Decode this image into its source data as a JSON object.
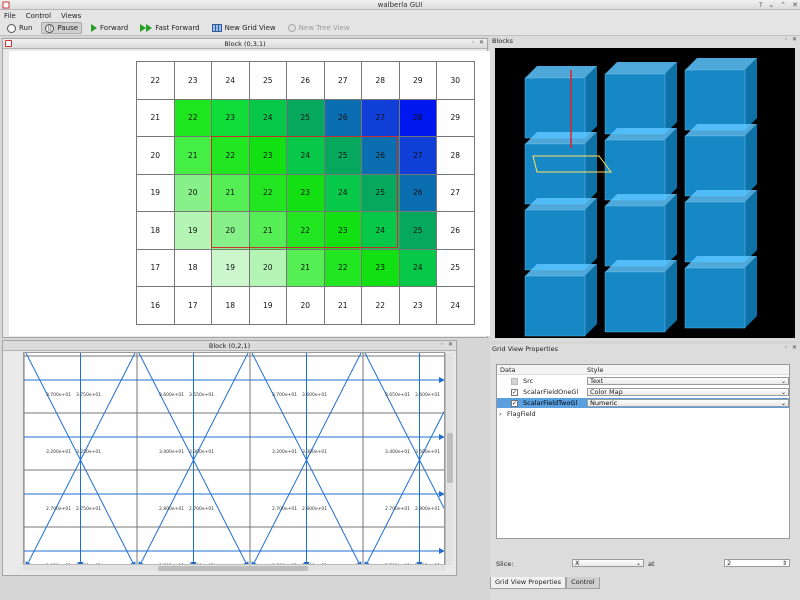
{
  "window": {
    "title": "walberla GUI"
  },
  "menu": [
    "File",
    "Control",
    "Views"
  ],
  "toolbar": {
    "run": "Run",
    "pause": "Pause",
    "forward": "Forward",
    "fast_forward": "Fast Forward",
    "new_grid_view": "New Grid View",
    "new_tree_view": "New Tree View"
  },
  "block1": {
    "title": "Block (0,3,1)",
    "rows": [
      [
        "22",
        "23",
        "24",
        "25",
        "26",
        "27",
        "28",
        "29",
        "30"
      ],
      [
        "21",
        "22",
        "23",
        "24",
        "25",
        "26",
        "27",
        "28",
        "29"
      ],
      [
        "20",
        "21",
        "22",
        "23",
        "24",
        "25",
        "26",
        "27",
        "28"
      ],
      [
        "19",
        "20",
        "21",
        "22",
        "23",
        "24",
        "25",
        "26",
        "27"
      ],
      [
        "18",
        "19",
        "20",
        "21",
        "22",
        "23",
        "24",
        "25",
        "26"
      ],
      [
        "17",
        "18",
        "19",
        "20",
        "21",
        "22",
        "23",
        "24",
        "25"
      ],
      [
        "16",
        "17",
        "18",
        "19",
        "20",
        "21",
        "22",
        "23",
        "24"
      ]
    ],
    "colors": [
      [
        "#ffffff",
        "#ffffff",
        "#ffffff",
        "#ffffff",
        "#ffffff",
        "#ffffff",
        "#ffffff",
        "#ffffff",
        "#ffffff"
      ],
      [
        "#ffffff",
        "#1ee61e",
        "#10dd3a",
        "#08c84a",
        "#06a85e",
        "#0a6eb0",
        "#1040d8",
        "#0018f0",
        "#ffffff"
      ],
      [
        "#ffffff",
        "#44ee44",
        "#22e622",
        "#12e012",
        "#08c84a",
        "#06a85e",
        "#0a6eb0",
        "#1040d8",
        "#ffffff"
      ],
      [
        "#ffffff",
        "#88f088",
        "#55ee55",
        "#22e622",
        "#12e012",
        "#08c84a",
        "#06a85e",
        "#0a6eb0",
        "#ffffff"
      ],
      [
        "#ffffff",
        "#b4f4b4",
        "#88f088",
        "#55ee55",
        "#22e622",
        "#12e012",
        "#08c84a",
        "#06a85e",
        "#ffffff"
      ],
      [
        "#ffffff",
        "#ffffff",
        "#ccf7cc",
        "#b4f4b4",
        "#55ee55",
        "#22e622",
        "#12e012",
        "#08c84a",
        "#ffffff"
      ],
      [
        "#ffffff",
        "#ffffff",
        "#ffffff",
        "#ffffff",
        "#ffffff",
        "#ffffff",
        "#ffffff",
        "#ffffff",
        "#ffffff"
      ]
    ]
  },
  "block2": {
    "title": "Block (0,2,1)",
    "labels": [
      [
        "3.700e+01",
        "3.750e+01",
        "3.600e+01",
        "3.550e+01",
        "3.700e+01",
        "3.600e+01",
        "3.650e+01",
        "3.600e+01"
      ],
      [
        "3.200e+01",
        "3.250e+01",
        "3.400e+01",
        "3.300e+01",
        "3.200e+01",
        "3.300e+01",
        "3.400e+01",
        "3.500e+01"
      ],
      [
        "2.700e+01",
        "2.750e+01",
        "2.800e+01",
        "2.700e+01",
        "2.700e+01",
        "2.800e+01",
        "2.700e+01",
        "2.900e+01"
      ],
      [
        "3.600e+01",
        "3.650e+01",
        "3.600e+01",
        "3.700e+01",
        "3.600e+01",
        "3.500e+01",
        "3.700e+01",
        "3.650e+01"
      ]
    ]
  },
  "blocks_panel": {
    "title": "Blocks"
  },
  "grid_view_properties": {
    "title": "Grid View Properties",
    "col_data": "Data",
    "col_style": "Style",
    "rows": [
      {
        "name": "Src",
        "style": "Text",
        "checked": false
      },
      {
        "name": "ScalarFieldOneGl",
        "style": "Color Map",
        "checked": true
      },
      {
        "name": "ScalarFieldTwoGl",
        "style": "Numeric",
        "checked": true
      }
    ],
    "flag_field": "FlagField",
    "slice_label": "Slice:",
    "slice_axis": "X",
    "at_label": "at",
    "slice_value": "2"
  },
  "tabs": [
    "Grid View Properties",
    "Control"
  ],
  "colors": {
    "selection": "#5aa0e0",
    "arrow": "#1f6fd0",
    "cube": "#1aa0e8"
  }
}
